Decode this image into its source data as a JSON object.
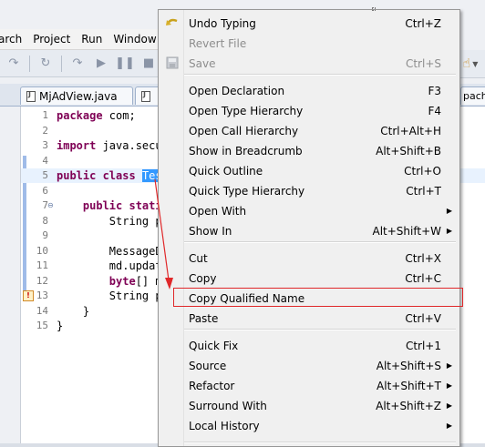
{
  "menubar": {
    "items": [
      "arch",
      "Project",
      "Run",
      "Window"
    ]
  },
  "tabs": [
    {
      "label": "MjAdView.java"
    },
    {
      "label": ""
    }
  ],
  "tab_right_fragment": "pach",
  "editor": {
    "line_numbers": [
      "1",
      "2",
      "3",
      "4",
      "5",
      "6",
      "7",
      "8",
      "9",
      "10",
      "11",
      "12",
      "13",
      "14",
      "15"
    ],
    "lines": [
      {
        "kw": "package",
        "rest": " com;"
      },
      {
        "kw": "",
        "rest": ""
      },
      {
        "kw": "import",
        "rest": " java.secu"
      },
      {
        "kw": "",
        "rest": ""
      },
      {
        "kw": "public class",
        "rest": " ",
        "selected": "Tes"
      },
      {
        "kw": "",
        "rest": ""
      },
      {
        "kw": "public stati",
        "rest": "",
        "indent": "    "
      },
      {
        "kw": "",
        "rest": "String p",
        "indent": "        "
      },
      {
        "kw": "",
        "rest": ""
      },
      {
        "kw": "",
        "rest": "MessageD",
        "indent": "        "
      },
      {
        "kw": "",
        "rest": "md.updat",
        "indent": "        "
      },
      {
        "kw": "byte",
        "rest": "[] m",
        "indent": "        "
      },
      {
        "kw": "",
        "rest": "String p",
        "indent": "        "
      },
      {
        "kw": "",
        "rest": "}",
        "indent": "    "
      },
      {
        "kw": "",
        "rest": "}"
      }
    ]
  },
  "context_menu": {
    "items": [
      {
        "label": "Undo Typing",
        "accel": "Ctrl+Z",
        "icon": "undo-icon"
      },
      {
        "label": "Revert File",
        "accel": "",
        "disabled": true
      },
      {
        "label": "Save",
        "accel": "Ctrl+S",
        "disabled": true,
        "icon": "save-icon"
      },
      {
        "label": "Open Declaration",
        "accel": "F3"
      },
      {
        "label": "Open Type Hierarchy",
        "accel": "F4"
      },
      {
        "label": "Open Call Hierarchy",
        "accel": "Ctrl+Alt+H"
      },
      {
        "label": "Show in Breadcrumb",
        "accel": "Alt+Shift+B"
      },
      {
        "label": "Quick Outline",
        "accel": "Ctrl+O"
      },
      {
        "label": "Quick Type Hierarchy",
        "accel": "Ctrl+T"
      },
      {
        "label": "Open With",
        "accel": "",
        "submenu": true
      },
      {
        "label": "Show In",
        "accel": "Alt+Shift+W",
        "submenu": true
      },
      {
        "label": "Cut",
        "accel": "Ctrl+X"
      },
      {
        "label": "Copy",
        "accel": "Ctrl+C"
      },
      {
        "label": "Copy Qualified Name",
        "accel": "",
        "highlighted": true
      },
      {
        "label": "Paste",
        "accel": "Ctrl+V"
      },
      {
        "label": "Quick Fix",
        "accel": "Ctrl+1"
      },
      {
        "label": "Source",
        "accel": "Alt+Shift+S",
        "submenu": true
      },
      {
        "label": "Refactor",
        "accel": "Alt+Shift+T",
        "submenu": true
      },
      {
        "label": "Surround With",
        "accel": "Alt+Shift+Z",
        "submenu": true
      },
      {
        "label": "Local History",
        "accel": "",
        "submenu": true
      }
    ]
  },
  "colors": {
    "keyword": "#7f0055",
    "selection": "#3399ff",
    "annotation": "#e0282a"
  }
}
